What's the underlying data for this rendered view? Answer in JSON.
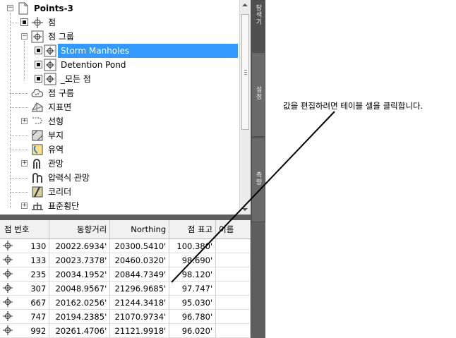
{
  "tree": {
    "root": {
      "label": "Points-3"
    },
    "items": [
      {
        "label": "점"
      },
      {
        "label": "점 그룹"
      },
      {
        "label": "Storm Manholes"
      },
      {
        "label": "Detention Pond"
      },
      {
        "label": "_모든 점"
      },
      {
        "label": "점 구름"
      },
      {
        "label": "지표면"
      },
      {
        "label": "선형"
      },
      {
        "label": "부지"
      },
      {
        "label": "유역"
      },
      {
        "label": "관망"
      },
      {
        "label": "압력식 관망"
      },
      {
        "label": "코리더"
      },
      {
        "label": "표준횡단"
      }
    ]
  },
  "side_tabs": [
    {
      "label": "탐색기"
    },
    {
      "label": "설정"
    },
    {
      "label": "측량"
    }
  ],
  "table": {
    "columns": [
      "점 번호",
      "동향거리",
      "Northing",
      "점 표고",
      "이름"
    ],
    "rows": [
      {
        "number": "130",
        "easting": "20022.6934'",
        "northing": "20300.5410'",
        "elevation": "100.380'",
        "name": ""
      },
      {
        "number": "133",
        "easting": "20023.7378'",
        "northing": "20460.0320'",
        "elevation": "98.690'",
        "name": ""
      },
      {
        "number": "235",
        "easting": "20034.1952'",
        "northing": "20844.7349'",
        "elevation": "98.120'",
        "name": ""
      },
      {
        "number": "307",
        "easting": "20048.9567'",
        "northing": "21296.9685'",
        "elevation": "97.747'",
        "name": ""
      },
      {
        "number": "667",
        "easting": "20162.0256'",
        "northing": "21244.3418'",
        "elevation": "95.030'",
        "name": ""
      },
      {
        "number": "747",
        "easting": "20194.2385'",
        "northing": "21070.9734'",
        "elevation": "96.780'",
        "name": ""
      },
      {
        "number": "992",
        "easting": "20261.4706'",
        "northing": "21121.9918'",
        "elevation": "96.020'",
        "name": ""
      }
    ]
  },
  "annotation": {
    "text": "값을 편집하려면 테이블 셀을 클릭합니다."
  },
  "colors": {
    "selection": "#3399ff",
    "panel_background": "#5e5e5e"
  }
}
